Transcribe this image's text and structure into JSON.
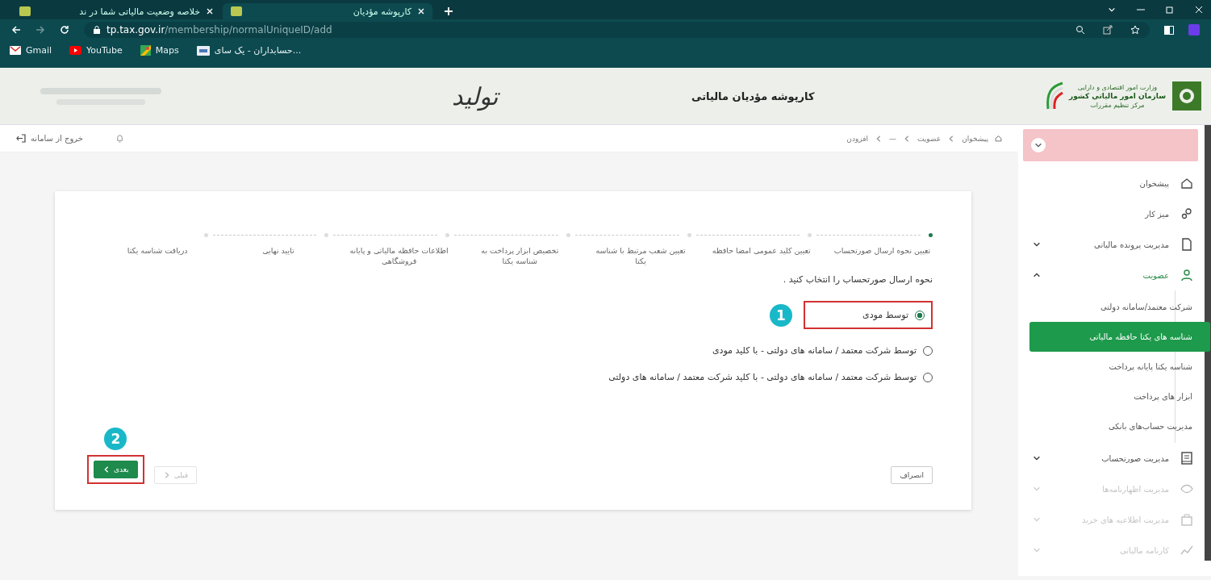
{
  "browser": {
    "tabs": [
      {
        "title": "کارپوشه مؤدیان",
        "selected": true
      },
      {
        "title": "خلاصه وضعیت مالیاتی شما در ند",
        "selected": false
      }
    ],
    "url_host": "tp.tax.gov.ir",
    "url_path": "/membership/normalUniqueID/add",
    "bookmarks": [
      {
        "label": "حسابداران - یک سای...",
        "kind": "site"
      },
      {
        "label": "Maps",
        "kind": "map"
      },
      {
        "label": "YouTube",
        "kind": "video"
      },
      {
        "label": "Gmail",
        "kind": "mail"
      }
    ]
  },
  "header": {
    "title": "کارپوشه مؤدیان مالیاتی",
    "slogan": "تولید",
    "logo_lines": [
      "وزارت امور اقتصادی و دارایی",
      "سازمان امور مالیاتی کشور",
      "مرکز تنظیم مقررات"
    ]
  },
  "topbar": {
    "logout": "خروج از سامانه",
    "breadcrumb": [
      "پیشخوان",
      "عضویت",
      "—",
      "افزودن"
    ]
  },
  "sidebar": {
    "items": [
      {
        "label": "پیشخوان",
        "kind": "link",
        "disabled": false
      },
      {
        "label": "میز کار",
        "kind": "link",
        "disabled": false
      },
      {
        "label": "مدیریت پرونده مالیاتی",
        "kind": "group",
        "expanded": false,
        "disabled": false
      },
      {
        "label": "عضویت",
        "kind": "group",
        "expanded": true,
        "disabled": false,
        "children": [
          {
            "label": "شرکت معتمد/سامانه دولتی",
            "selected": false
          },
          {
            "label": "شناسه های یکتا حافظه مالیاتی",
            "selected": true
          },
          {
            "label": "شناسه یکتا پایانه پرداخت",
            "selected": false
          },
          {
            "label": "ابزار های پرداخت",
            "selected": false
          },
          {
            "label": "مدیریت حساب‌های بانکی",
            "selected": false
          }
        ]
      },
      {
        "label": "مدیریت صورتحساب",
        "kind": "group",
        "expanded": false,
        "disabled": false
      },
      {
        "label": "مدیریت اظهارنامه‌ها",
        "kind": "group",
        "expanded": false,
        "disabled": true
      },
      {
        "label": "مدیریت اطلاعیه های خرید",
        "kind": "group",
        "expanded": false,
        "disabled": true
      },
      {
        "label": "کارنامه مالیاتی",
        "kind": "group",
        "expanded": false,
        "disabled": true
      }
    ]
  },
  "wizard": {
    "steps": [
      {
        "label": "تعیین نحوه ارسال صورتحساب",
        "selected": true
      },
      {
        "label": "تعیین کلید عمومی امضا حافظه",
        "selected": false
      },
      {
        "label": "تعیین شعب مرتبط با شناسه یکتا",
        "selected": false
      },
      {
        "label": "تخصیص ابزار پرداخت به شناسه یکتا",
        "selected": false
      },
      {
        "label": "اطلاعات حافظه مالیاتی و پایانه فروشگاهی",
        "selected": false
      },
      {
        "label": "تایید نهایی",
        "selected": false
      },
      {
        "label": "دریافت شناسه یکتا",
        "selected": false
      }
    ],
    "question": "نحوه ارسال صورتحساب را انتخاب کنید .",
    "options": [
      {
        "label": "توسط مودی",
        "selected": true,
        "annotation": "1"
      },
      {
        "label": "توسط شرکت معتمد / سامانه های دولتی - با کلید مودی",
        "selected": false
      },
      {
        "label": "توسط شرکت معتمد / سامانه های دولتی - با کلید شرکت معتمد / سامانه های دولتی",
        "selected": false
      }
    ],
    "buttons": [
      {
        "label": "انصراف",
        "kind": "cancel",
        "disabled": false
      },
      {
        "label": "قبلی",
        "kind": "prev",
        "disabled": true
      },
      {
        "label": "بعدی",
        "kind": "next",
        "disabled": false,
        "annotation": "2"
      }
    ]
  }
}
